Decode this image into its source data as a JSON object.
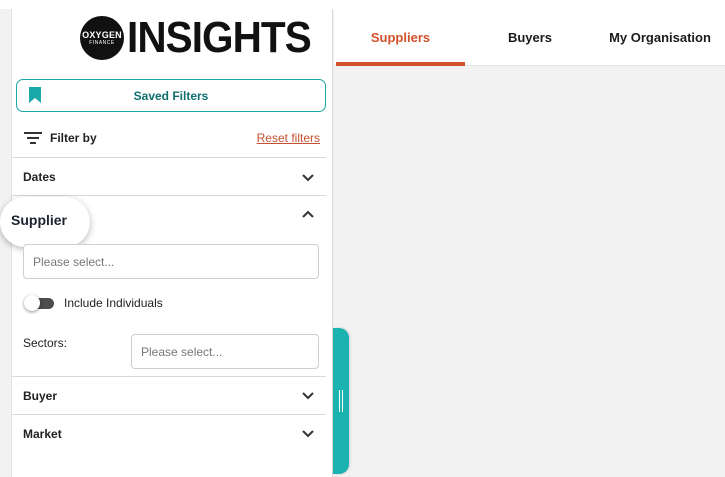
{
  "logo": {
    "circle_line1": "OXYGEN",
    "circle_line2": "FINANCE",
    "wordmark": "INSIGHTS"
  },
  "sidebar": {
    "saved_filters_label": "Saved Filters",
    "filter_by_label": "Filter by",
    "reset_filters_label": "Reset filters",
    "sections": {
      "dates": {
        "title": "Dates",
        "expanded": false
      },
      "supplier": {
        "title": "Supplier",
        "expanded": true,
        "select_placeholder": "Please select...",
        "include_individuals_label": "Include Individuals",
        "include_individuals_on": false,
        "sectors_label": "Sectors:",
        "sectors_placeholder": "Please select..."
      },
      "buyer": {
        "title": "Buyer",
        "expanded": false
      },
      "market": {
        "title": "Market",
        "expanded": false
      }
    }
  },
  "tabs": [
    {
      "label": "Suppliers",
      "active": true
    },
    {
      "label": "Buyers",
      "active": false
    },
    {
      "label": "My Organisation",
      "active": false
    }
  ],
  "colors": {
    "accent_teal": "#1ab3b0",
    "active_tab": "#d1522a",
    "reset_link": "#c4522f"
  }
}
